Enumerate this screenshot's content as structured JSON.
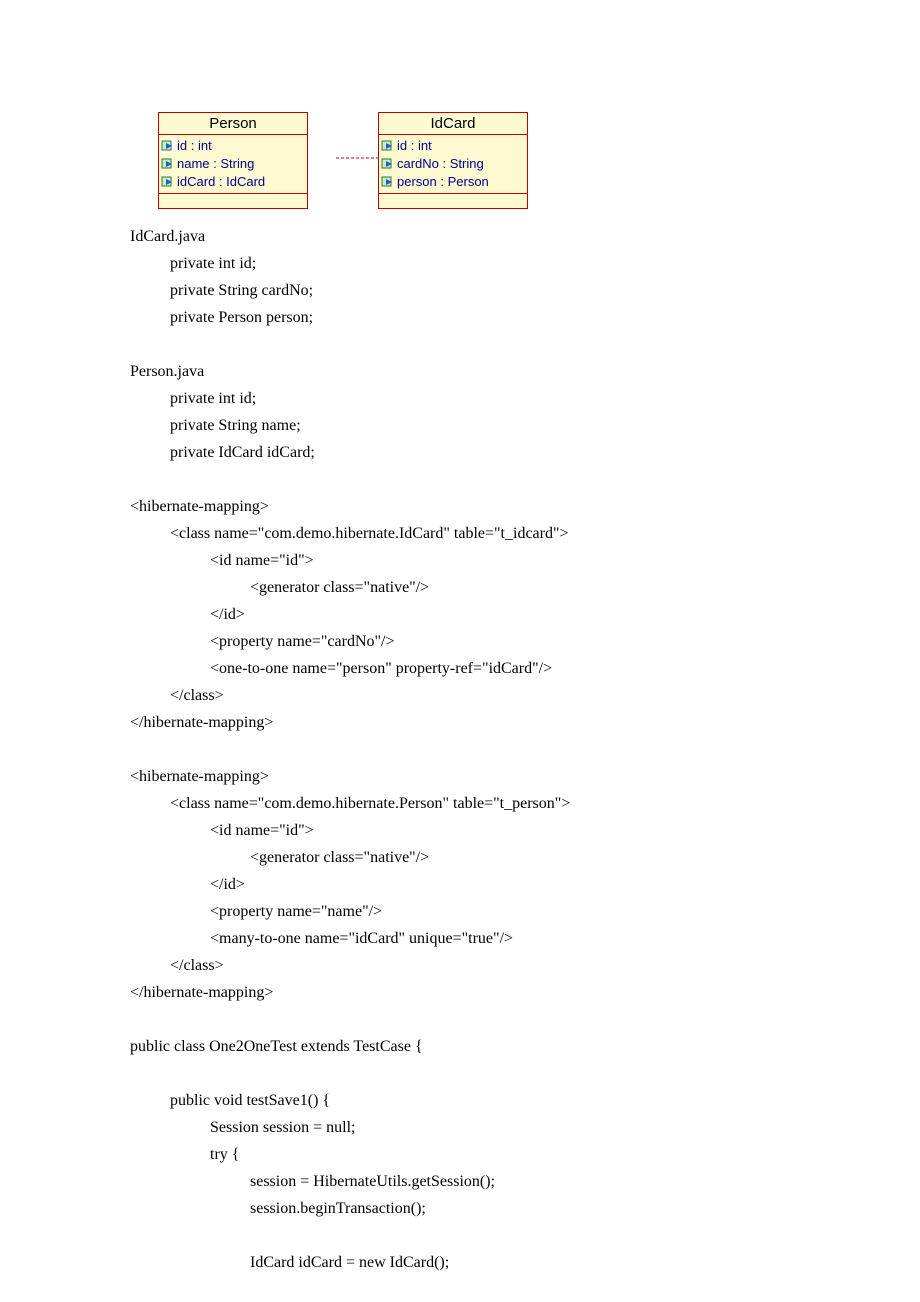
{
  "uml": {
    "person": {
      "title": "Person",
      "attrs": [
        "id : int",
        "name : String",
        "idCard : IdCard"
      ]
    },
    "idcard": {
      "title": "IdCard",
      "attrs": [
        "id : int",
        "cardNo : String",
        "person : Person"
      ]
    }
  },
  "sections": {
    "idcard_file": "IdCard.java",
    "idcard_lines": [
      "private int id;",
      "private String cardNo;",
      "private Person person;"
    ],
    "person_file": "Person.java",
    "person_lines": [
      "private int id;",
      "private String name;",
      "private IdCard idCard;"
    ],
    "hm1": {
      "open": "<hibernate-mapping>",
      "class_open": "<class name=\"com.demo.hibernate.IdCard\" table=\"t_idcard\">",
      "id_open": "<id name=\"id\">",
      "gen": "<generator class=\"native\"/>",
      "id_close": "</id>",
      "prop": "<property name=\"cardNo\"/>",
      "rel": "<one-to-one name=\"person\" property-ref=\"idCard\"/>",
      "class_close": "</class>",
      "close": "</hibernate-mapping>"
    },
    "hm2": {
      "open": "<hibernate-mapping>",
      "class_open": "<class name=\"com.demo.hibernate.Person\" table=\"t_person\">",
      "id_open": "<id name=\"id\">",
      "gen": "<generator class=\"native\"/>",
      "id_close": "</id>",
      "prop": "<property name=\"name\"/>",
      "rel": "<many-to-one name=\"idCard\" unique=\"true\"/>",
      "class_close": "</class>",
      "close": "</hibernate-mapping>"
    },
    "test": {
      "class_decl": "public class One2OneTest extends TestCase {",
      "method": "public void testSave1() {",
      "l1": "Session session = null;",
      "l2": "try {",
      "l3": "session = HibernateUtils.getSession();",
      "l4": "session.beginTransaction();",
      "l5": "IdCard idCard = new IdCard();"
    }
  }
}
